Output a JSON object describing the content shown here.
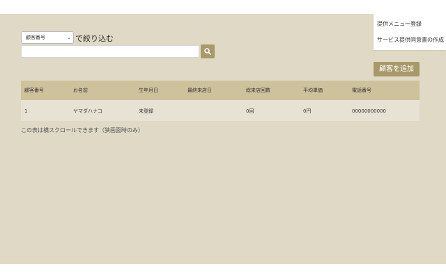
{
  "menu": {
    "items": [
      "提供メニュー登録",
      "サービス提供同意書の作成"
    ]
  },
  "filter": {
    "select_value": "顧客番号",
    "label": "で絞り込む",
    "search_placeholder": ""
  },
  "actions": {
    "add_customer": "顧客を追加"
  },
  "table": {
    "headers": [
      "顧客番号",
      "お名前",
      "生年月日",
      "最終来店日",
      "総来店回数",
      "平均単価",
      "電話番号"
    ],
    "rows": [
      [
        "1",
        "ヤマダハナコ",
        "未登録",
        "",
        "0回",
        "0円",
        "00000000000"
      ]
    ]
  },
  "note": "この表は横スクロールできます（狭画面時のみ）",
  "colors": {
    "background": "#dfd9c5",
    "accent": "#a8996a",
    "header_bg": "#cdc29c",
    "row_bg": "#e7e2d4"
  },
  "icons": {
    "search": "search-icon",
    "select": "chevron-down-icon"
  }
}
